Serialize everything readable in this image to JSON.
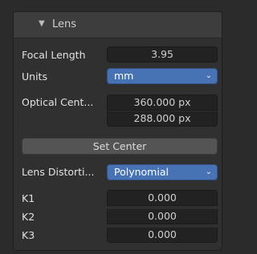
{
  "panel": {
    "title": "Lens",
    "collapse_icon": "triangle-down-icon"
  },
  "focal_length": {
    "label": "Focal Length",
    "value": "3.95"
  },
  "units": {
    "label": "Units",
    "value": "mm",
    "icon": "chevron-down-icon"
  },
  "optical_center": {
    "label": "Optical Cent...",
    "x": "360.000 px",
    "y": "288.000 px"
  },
  "set_center_button": "Set Center",
  "lens_distortion": {
    "label": "Lens Distorti...",
    "value": "Polynomial",
    "icon": "chevron-down-icon"
  },
  "k1": {
    "label": "K1",
    "value": "0.000"
  },
  "k2": {
    "label": "K2",
    "value": "0.000"
  },
  "k3": {
    "label": "K3",
    "value": "0.000"
  },
  "colors": {
    "accent": "#4772b3",
    "panel": "#303030",
    "field": "#222222"
  }
}
